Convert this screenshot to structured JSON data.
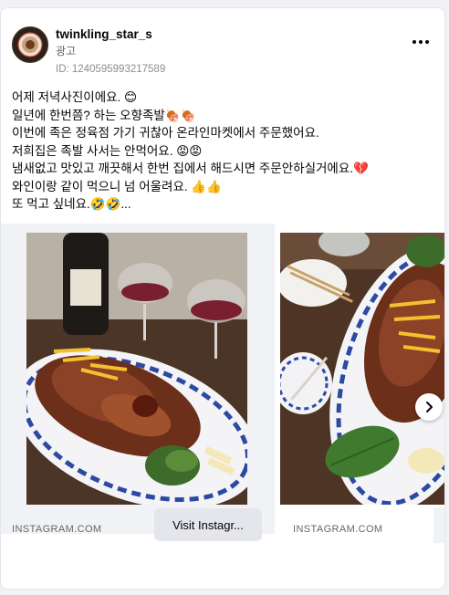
{
  "post": {
    "username": "twinkling_star_s",
    "sponsored_label": "광고",
    "ad_id": "ID: 1240595993217589",
    "more_icon": "more-horizontal-icon"
  },
  "caption": {
    "lines": [
      "어제 저녁사진이에요. 😊",
      "일년에 한번쯤? 하는 오향족발🍖🍖",
      "이번에 족은 정육점 가기 귀찮아 온라인마켓에서 주문했어요.",
      "저희집은 족발 사서는 안먹어요. 😡😡",
      "냄새없고 맛있고 깨끗해서 한번 집에서 해드시면 주문안하실거에요.💔",
      "와인이랑 같이 먹으니 넘 어울려요. 👍👍",
      "또 먹고 싶네요.🤣🤣..."
    ]
  },
  "carousel": {
    "slides": [
      {
        "source": "INSTAGRAM.COM",
        "button_label": "Visit Instagr..."
      },
      {
        "source": "INSTAGRAM.COM"
      }
    ],
    "next_icon": "chevron-right-icon"
  },
  "colors": {
    "primary_text": "#050505",
    "secondary_text": "#65676b",
    "button_bg": "#e4e6eb",
    "page_bg": "#f0f2f5"
  }
}
